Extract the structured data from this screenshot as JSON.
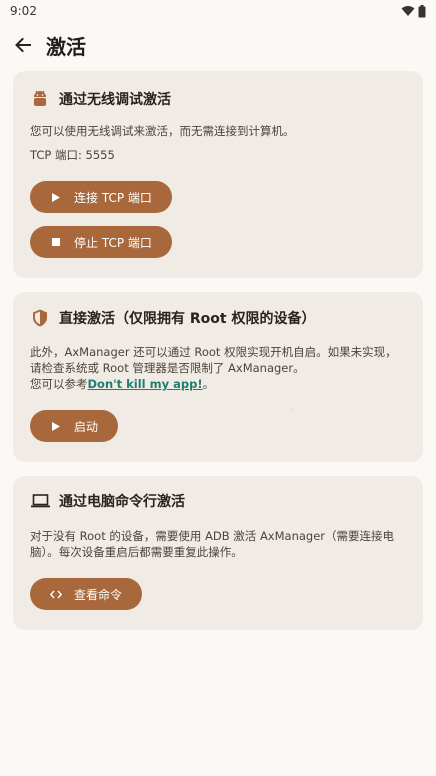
{
  "status_bar": {
    "time": "9:02"
  },
  "header": {
    "title": "激活"
  },
  "cards": [
    {
      "title": "通过无线调试激活",
      "description": "您可以使用无线调试来激活，而无需连接到计算机。",
      "port_text": "TCP 端口: 5555",
      "buttons": [
        {
          "label": "连接 TCP 端口"
        },
        {
          "label": "停止 TCP 端口"
        }
      ]
    },
    {
      "title": "直接激活（仅限拥有 Root 权限的设备）",
      "description_line1": "此外，AxManager 还可以通过 Root 权限实现开机自启。如果未实现，请检查系统或 Root 管理器是否限制了 AxManager。",
      "description_prefix": "您可以参考",
      "link_text": "Don't kill my app!",
      "description_suffix": "。",
      "buttons": [
        {
          "label": "启动"
        }
      ]
    },
    {
      "title": "通过电脑命令行激活",
      "description": "对于没有 Root 的设备，需要使用 ADB 激活 AxManager（需要连接电脑）。每次设备重启后都需要重复此操作。",
      "buttons": [
        {
          "label": "查看命令"
        }
      ]
    }
  ],
  "colors": {
    "background": "#fbf8f5",
    "card": "#f1ebe5",
    "button": "#a8683c",
    "link": "#1f7f6e"
  },
  "icons": {
    "back": "arrow-left-icon",
    "card1": "android-icon",
    "card2": "shield-icon",
    "card3": "laptop-icon",
    "start": "play-icon",
    "stop": "stop-icon",
    "code": "code-icon"
  }
}
